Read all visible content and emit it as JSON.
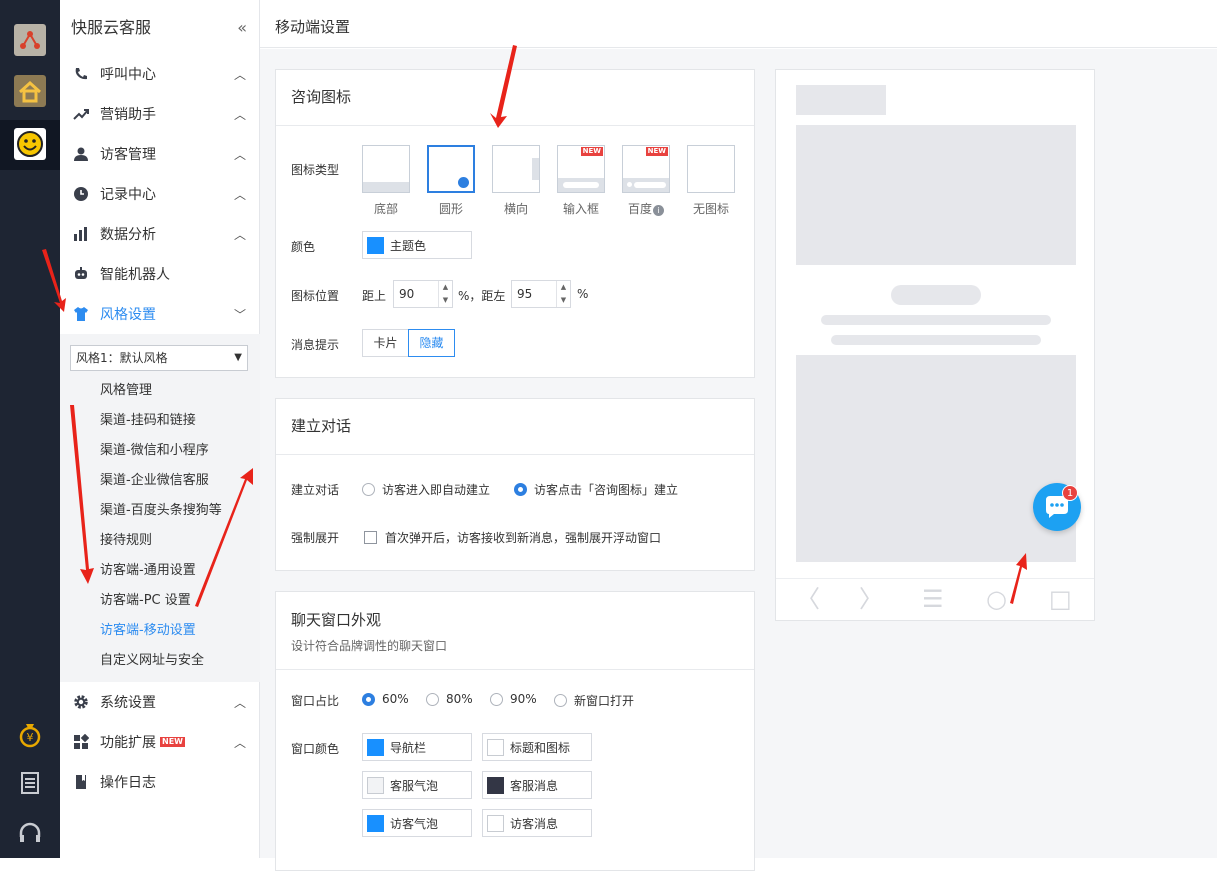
{
  "app": {
    "title": "快服云客服"
  },
  "rail": {
    "icons": [
      "yellow-app-icon",
      "home-icon",
      "smiley-icon",
      "money-bag-icon",
      "document-icon",
      "headset-icon"
    ]
  },
  "sidebar": {
    "items": [
      {
        "label": "呼叫中心",
        "icon": "phone-icon"
      },
      {
        "label": "营销助手",
        "icon": "trend-icon"
      },
      {
        "label": "访客管理",
        "icon": "user-icon"
      },
      {
        "label": "记录中心",
        "icon": "clock-icon"
      },
      {
        "label": "数据分析",
        "icon": "bar-chart-icon"
      },
      {
        "label": "智能机器人",
        "icon": "robot-icon"
      },
      {
        "label": "风格设置",
        "icon": "shirt-icon"
      },
      {
        "label": "系统设置",
        "icon": "gear-icon"
      },
      {
        "label": "功能扩展",
        "icon": "grid-icon",
        "badge": "NEW"
      },
      {
        "label": "操作日志",
        "icon": "book-icon"
      }
    ],
    "style_select": "风格1：默认风格",
    "sub_items": [
      "风格管理",
      "渠道-挂码和链接",
      "渠道-微信和小程序",
      "渠道-企业微信客服",
      "渠道-百度头条搜狗等",
      "接待规则",
      "访客端-通用设置",
      "访客端-PC 设置",
      "访客端-移动设置",
      "自定义网址与安全"
    ]
  },
  "page": {
    "title": "移动端设置"
  },
  "consult_icon": {
    "title": "咨询图标",
    "type_label": "图标类型",
    "types": [
      "底部",
      "圆形",
      "横向",
      "输入框",
      "百度",
      "无图标"
    ],
    "badges": {
      "new": "NEW"
    },
    "color_label": "颜色",
    "color_value": "主题色",
    "position_label": "图标位置",
    "top_label": "距上",
    "top_value": "90",
    "left_label": "%，距左",
    "left_value": "95",
    "percent": "%",
    "msg_label": "消息提示",
    "msg_options": [
      "卡片",
      "隐藏"
    ]
  },
  "dialog": {
    "title": "建立对话",
    "create_label": "建立对话",
    "options": [
      "访客进入即自动建立",
      "访客点击「咨询图标」建立"
    ],
    "force_label": "强制展开",
    "force_text": "首次弹开后，访客接收到新消息，强制展开浮动窗口"
  },
  "chat_window": {
    "title": "聊天窗口外观",
    "subtitle": "设计符合品牌调性的聊天窗口",
    "ratio_label": "窗口占比",
    "ratios": [
      "60%",
      "80%",
      "90%",
      "新窗口打开"
    ],
    "color_label": "窗口颜色",
    "colors": [
      {
        "label": "导航栏",
        "color": "#1890ff"
      },
      {
        "label": "标题和图标",
        "color": "#ffffff"
      },
      {
        "label": "客服气泡",
        "color": "#f2f3f5"
      },
      {
        "label": "客服消息",
        "color": "#333645"
      },
      {
        "label": "访客气泡",
        "color": "#1890ff"
      },
      {
        "label": "访客消息",
        "color": "#ffffff"
      }
    ]
  },
  "preview": {
    "badge_count": "1"
  },
  "theme": {
    "accent": "#2d8cf0",
    "rail_bg": "#1e2533",
    "arrow": "#e8231a"
  }
}
